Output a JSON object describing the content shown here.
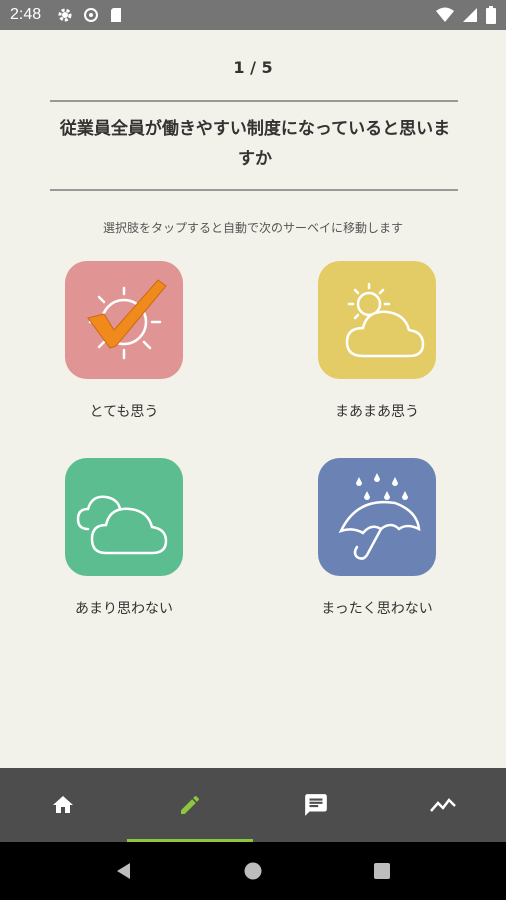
{
  "status_bar": {
    "time": "2:48"
  },
  "survey": {
    "counter": "1 / 5",
    "question": "従業員全員が働きやすい制度になっていると思いますか",
    "hint": "選択肢をタップすると自動で次のサーベイに移動します",
    "options": [
      {
        "label": "とても思う",
        "color": "#e19494",
        "icon": "sun-icon",
        "selected": true
      },
      {
        "label": "まあまあ思う",
        "color": "#e3cc65",
        "icon": "sun-cloud-icon",
        "selected": false
      },
      {
        "label": "あまり思わない",
        "color": "#5cbd91",
        "icon": "clouds-icon",
        "selected": false
      },
      {
        "label": "まったく思わない",
        "color": "#6a82b4",
        "icon": "umbrella-rain-icon",
        "selected": false
      }
    ],
    "check_color": "#f08a1c"
  },
  "nav": {
    "active_color": "#8dc63f",
    "items": [
      {
        "icon": "home-icon",
        "active": false
      },
      {
        "icon": "pencil-icon",
        "active": true
      },
      {
        "icon": "chat-icon",
        "active": false
      },
      {
        "icon": "trend-icon",
        "active": false
      }
    ]
  }
}
